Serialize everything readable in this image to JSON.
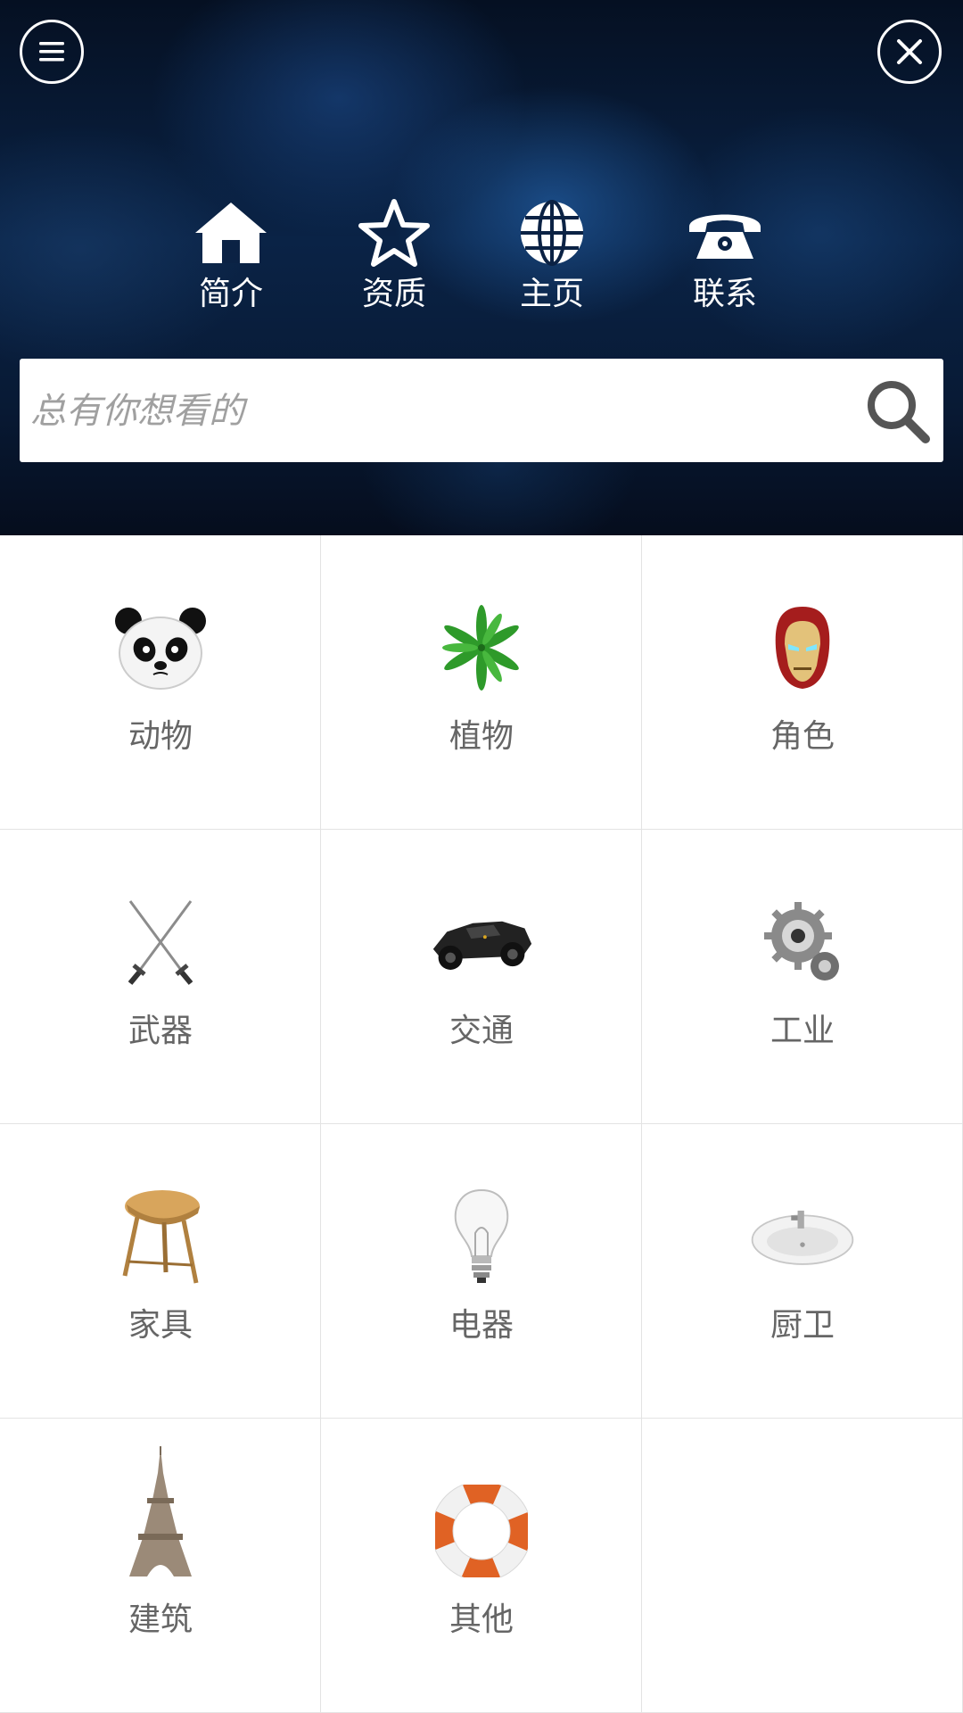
{
  "header": {
    "menu_icon": "hamburger-menu-icon",
    "close_icon": "close-icon",
    "nav": [
      {
        "label": "简介",
        "icon": "home-icon"
      },
      {
        "label": "资质",
        "icon": "star-icon"
      },
      {
        "label": "主页",
        "icon": "globe-icon"
      },
      {
        "label": "联系",
        "icon": "telephone-icon"
      }
    ]
  },
  "search": {
    "placeholder": "总有你想看的",
    "icon": "search-icon"
  },
  "categories": [
    {
      "label": "动物",
      "icon": "panda-icon"
    },
    {
      "label": "植物",
      "icon": "leaf-plant-icon"
    },
    {
      "label": "角色",
      "icon": "iron-man-helmet-icon"
    },
    {
      "label": "武器",
      "icon": "crossed-swords-icon"
    },
    {
      "label": "交通",
      "icon": "batmobile-car-icon"
    },
    {
      "label": "工业",
      "icon": "gears-icon"
    },
    {
      "label": "家具",
      "icon": "wooden-stool-icon"
    },
    {
      "label": "电器",
      "icon": "light-bulb-icon"
    },
    {
      "label": "厨卫",
      "icon": "sink-basin-icon"
    },
    {
      "label": "建筑",
      "icon": "eiffel-tower-icon"
    },
    {
      "label": "其他",
      "icon": "life-buoy-icon"
    }
  ],
  "colors": {
    "header_bg": "#0a2346",
    "label_text": "#666666",
    "grid_line": "#e3e3e3"
  }
}
